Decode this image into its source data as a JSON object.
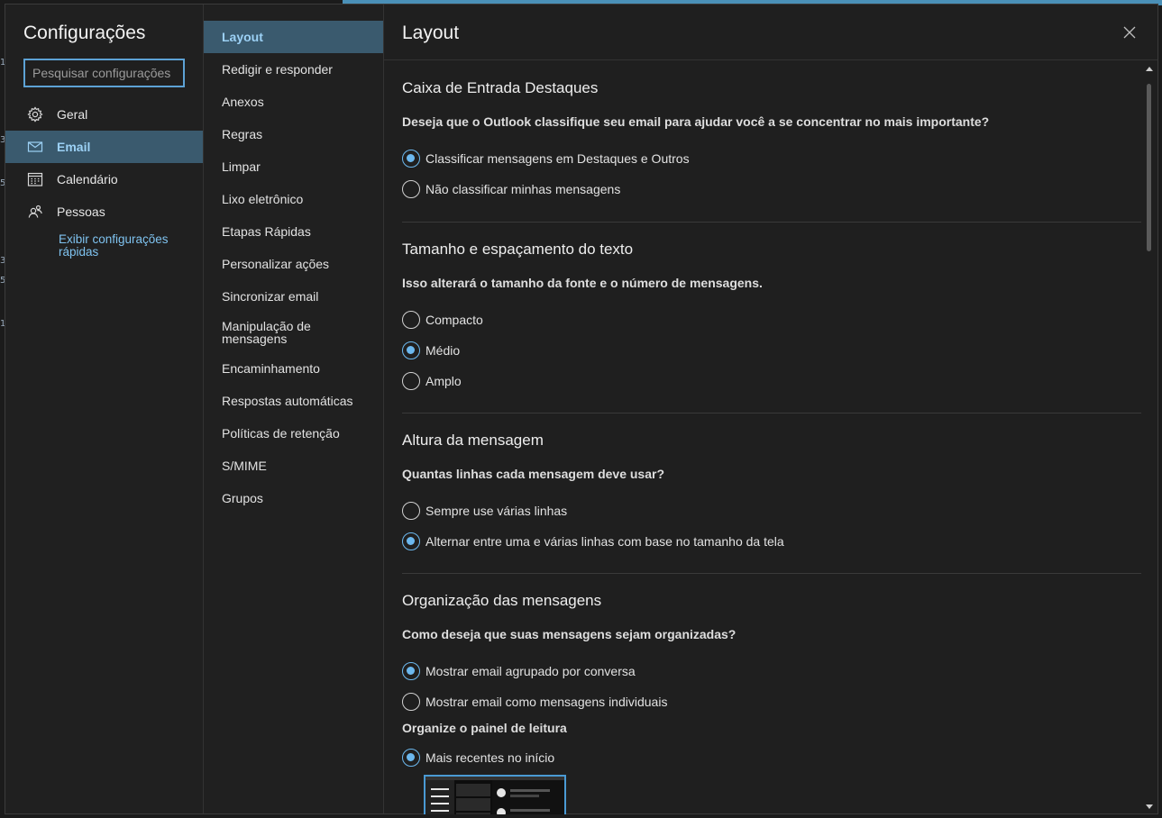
{
  "settings_panel": {
    "title": "Configurações",
    "search": {
      "placeholder": "Pesquisar configurações",
      "value": ""
    },
    "categories": [
      {
        "label": "Geral",
        "icon": "gear-icon",
        "active": false
      },
      {
        "label": "Email",
        "icon": "mail-icon",
        "active": true
      },
      {
        "label": "Calendário",
        "icon": "calendar-icon",
        "active": false
      },
      {
        "label": "Pessoas",
        "icon": "people-icon",
        "active": false
      }
    ],
    "quick_settings_link": "Exibir configurações rápidas"
  },
  "email_subnav": {
    "items": [
      "Layout",
      "Redigir e responder",
      "Anexos",
      "Regras",
      "Limpar",
      "Lixo eletrônico",
      "Etapas Rápidas",
      "Personalizar ações",
      "Sincronizar email",
      "Manipulação de mensagens",
      "Encaminhamento",
      "Respostas automáticas",
      "Políticas de retenção",
      "S/MIME",
      "Grupos"
    ],
    "active_index": 0
  },
  "main": {
    "title": "Layout",
    "close_icon": "close-icon",
    "sections": [
      {
        "title": "Caixa de Entrada Destaques",
        "question": "Deseja que o Outlook classifique seu email para ajudar você a se concentrar no mais importante?",
        "options": [
          {
            "label": "Classificar mensagens em Destaques e Outros",
            "checked": true
          },
          {
            "label": "Não classificar minhas mensagens",
            "checked": false
          }
        ]
      },
      {
        "title": "Tamanho e espaçamento do texto",
        "question": "Isso alterará o tamanho da fonte e o número de mensagens.",
        "options": [
          {
            "label": "Compacto",
            "checked": false
          },
          {
            "label": "Médio",
            "checked": true
          },
          {
            "label": "Amplo",
            "checked": false
          }
        ]
      },
      {
        "title": "Altura da mensagem",
        "question": "Quantas linhas cada mensagem deve usar?",
        "options": [
          {
            "label": "Sempre use várias linhas",
            "checked": false
          },
          {
            "label": "Alternar entre uma e várias linhas com base no tamanho da tela",
            "checked": true
          }
        ]
      },
      {
        "title": "Organização das mensagens",
        "question": "Como deseja que suas mensagens sejam organizadas?",
        "options": [
          {
            "label": "Mostrar email agrupado por conversa",
            "checked": true
          },
          {
            "label": "Mostrar email como mensagens individuais",
            "checked": false
          }
        ],
        "sub_label": "Organize o painel de leitura",
        "sub_options": [
          {
            "label": "Mais recentes no início",
            "checked": true
          }
        ]
      }
    ]
  },
  "colors": {
    "accent": "#6cb8ee",
    "active_nav_bg": "#3a5a6e",
    "link": "#7fc3f0",
    "background": "#1f1f1f"
  },
  "background_edge_digits": [
    "1",
    "3",
    "5",
    "3",
    "5",
    "1"
  ]
}
